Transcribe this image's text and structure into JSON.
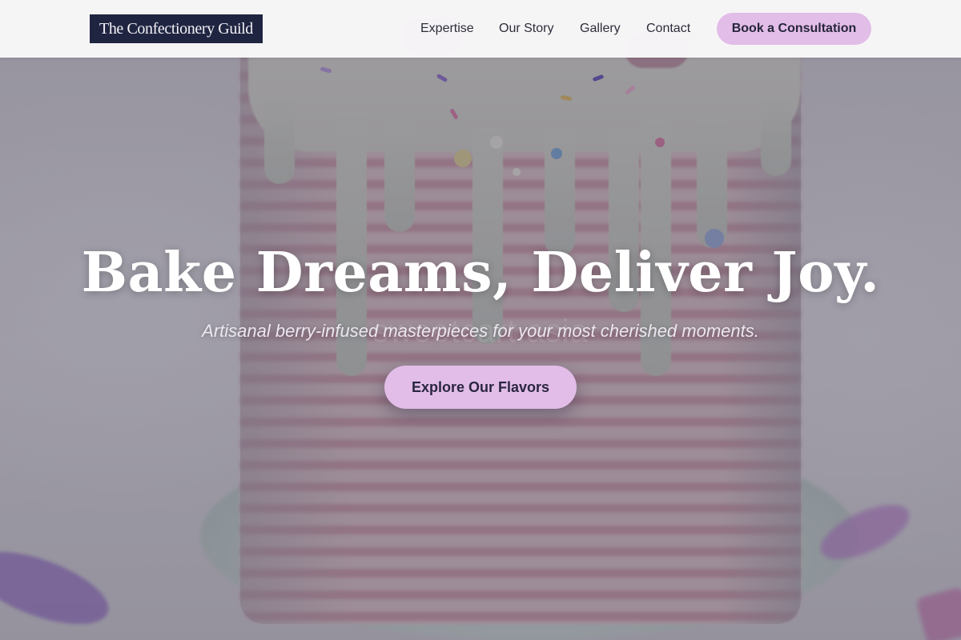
{
  "nav": {
    "brand": "The Confectionery Guild",
    "links": [
      {
        "label": "Expertise"
      },
      {
        "label": "Our Story"
      },
      {
        "label": "Gallery"
      },
      {
        "label": "Contact"
      }
    ],
    "cta_label": "Book a Consultation"
  },
  "hero": {
    "headline": "Bake Dreams, Deliver Joy.",
    "subheadline": "Artisanal berry-infused masterpieces for your most cherished moments.",
    "cta_label": "Explore Our Flavors",
    "watermark": "sweetcart.asia",
    "background_image": "striped pink drip cake with macarons and sprinkles"
  },
  "colors": {
    "navbar_bg": "#faf9fa",
    "brand_bg": "#1f2541",
    "cta_bg": "#e2bde8",
    "overlay": "#28243a"
  }
}
